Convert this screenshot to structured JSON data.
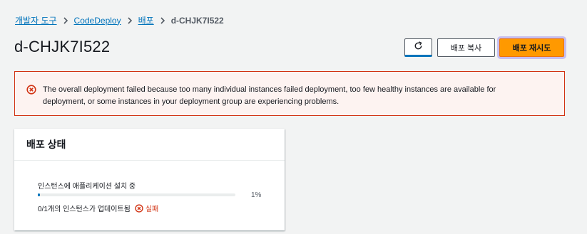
{
  "breadcrumb": [
    {
      "label": "개발자 도구"
    },
    {
      "label": "CodeDeploy"
    },
    {
      "label": "배포"
    },
    {
      "label": "d-CHJK7I522"
    }
  ],
  "page": {
    "title": "d-CHJK7I522"
  },
  "actions": {
    "refresh_icon": "refresh-icon",
    "copy_label": "배포 복사",
    "retry_label": "배포 재시도"
  },
  "alert": {
    "icon": "error-circle-icon",
    "line1": "The overall deployment failed because too many individual instances failed deployment, too few healthy instances are available for",
    "line2": "deployment, or some instances in your deployment group are experiencing problems."
  },
  "status_card": {
    "title": "배포 상태",
    "step_label": "인스턴스에 애플리케이션 설치 중",
    "progress_percent": 1,
    "progress_text": "1%",
    "updated_text": "0/1개의 인스턴스가 업데이트됨",
    "status_label": "실패"
  },
  "colors": {
    "link": "#0073bb",
    "error": "#d13212",
    "primary": "#ff9900"
  }
}
